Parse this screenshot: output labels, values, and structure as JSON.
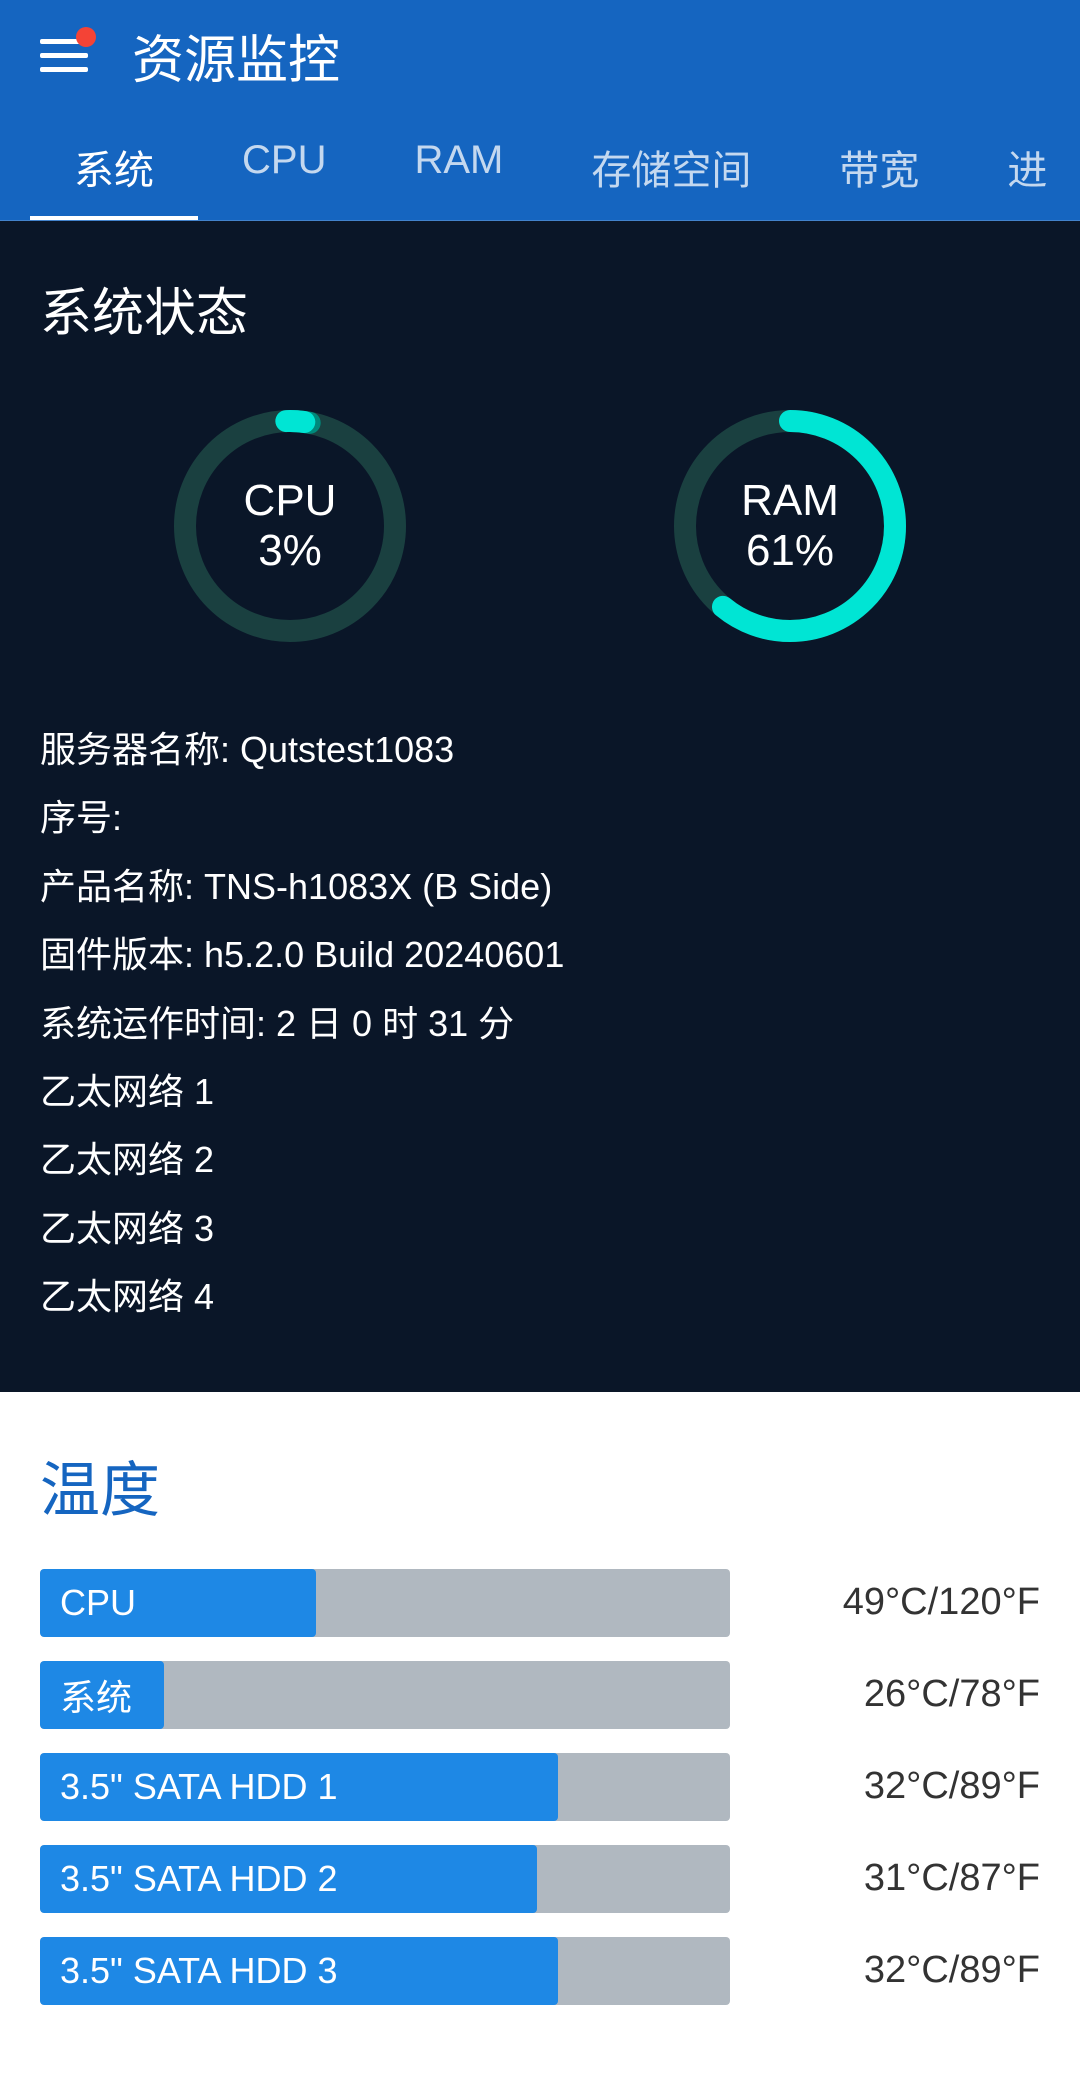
{
  "header": {
    "title": "资源监控"
  },
  "tabs": [
    {
      "label": "系统",
      "active": true
    },
    {
      "label": "CPU",
      "active": false
    },
    {
      "label": "RAM",
      "active": false
    },
    {
      "label": "存储空间",
      "active": false
    },
    {
      "label": "带宽",
      "active": false
    },
    {
      "label": "进",
      "active": false
    }
  ],
  "system_status": {
    "title": "系统状态",
    "cpu": {
      "label": "CPU",
      "value": "3%",
      "percent": 3
    },
    "ram": {
      "label": "RAM",
      "value": "61%",
      "percent": 61
    },
    "info": {
      "server_name_label": "服务器名称:",
      "server_name_value": "Qutstest1083",
      "serial_label": "序号:",
      "serial_value": "",
      "product_label": "产品名称:",
      "product_value": "TNS-h1083X (B Side)",
      "firmware_label": "固件版本:",
      "firmware_value": "h5.2.0 Build 20240601",
      "uptime_label": "系统运作时间:",
      "uptime_value": "2 日 0 时 31 分",
      "networks": [
        "乙太网络 1",
        "乙太网络 2",
        "乙太网络 3",
        "乙太网络 4"
      ]
    }
  },
  "temperature": {
    "title": "温度",
    "items": [
      {
        "label": "CPU",
        "fill_percent": 40,
        "value": "49°C/120°F"
      },
      {
        "label": "系统",
        "fill_percent": 18,
        "value": "26°C/78°F"
      },
      {
        "label": "3.5\" SATA HDD 1",
        "fill_percent": 75,
        "value": "32°C/89°F"
      },
      {
        "label": "3.5\" SATA HDD 2",
        "fill_percent": 72,
        "value": "31°C/87°F"
      },
      {
        "label": "3.5\" SATA HDD 3",
        "fill_percent": 75,
        "value": "32°C/89°F"
      }
    ]
  },
  "colors": {
    "header_bg": "#1565c0",
    "dark_bg": "#0a1628",
    "cpu_gauge_track": "#1a4040",
    "cpu_gauge_fill": "#00897b",
    "ram_gauge_track": "#1a4040",
    "ram_gauge_fill": "#00e5d4",
    "bar_fill": "#1e88e5",
    "bar_bg": "#b0b8c0"
  }
}
